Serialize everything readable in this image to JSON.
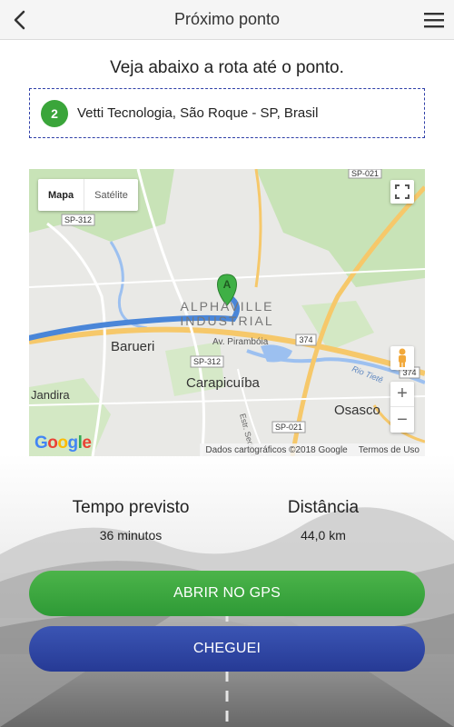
{
  "header": {
    "title": "Próximo ponto",
    "back_icon": "chevron-left-icon",
    "menu_icon": "hamburger-menu-icon"
  },
  "main": {
    "subtitle": "Veja abaixo a rota até o ponto.",
    "stop": {
      "number": "2",
      "address": "Vetti Tecnologia, São Roque - SP, Brasil"
    }
  },
  "map": {
    "type_map": "Mapa",
    "type_satellite": "Satélite",
    "marker_label": "A",
    "place_labels": {
      "alphaville_1": "ALPHAVILLE",
      "alphaville_2": "INDUSTRIAL",
      "barueri": "Barueri",
      "carapicuiba": "Carapicuíba",
      "jandira": "Jandira",
      "osasco": "Osasco",
      "pirambóia": "Av. Pirambóia",
      "tiete": "Rio Tietê",
      "sedeco": "Estr. Sedeco"
    },
    "road_labels": {
      "sp312_a": "SP-312",
      "sp312_b": "SP-312",
      "sp021_top": "SP-021",
      "sp021_bottom": "SP-021",
      "r374_a": "374",
      "r374_b": "374"
    },
    "attribution": "Dados cartográficos ©2018 Google",
    "terms": "Termos de Uso",
    "google": "Google"
  },
  "stats": {
    "time_label": "Tempo previsto",
    "time_value": "36 minutos",
    "distance_label": "Distância",
    "distance_value": "44,0 km"
  },
  "actions": {
    "open_gps": "ABRIR NO GPS",
    "arrived": "CHEGUEI"
  },
  "colors": {
    "green": "#3aa53a",
    "blue": "#2f3fa8",
    "route": "#4a86d8"
  }
}
